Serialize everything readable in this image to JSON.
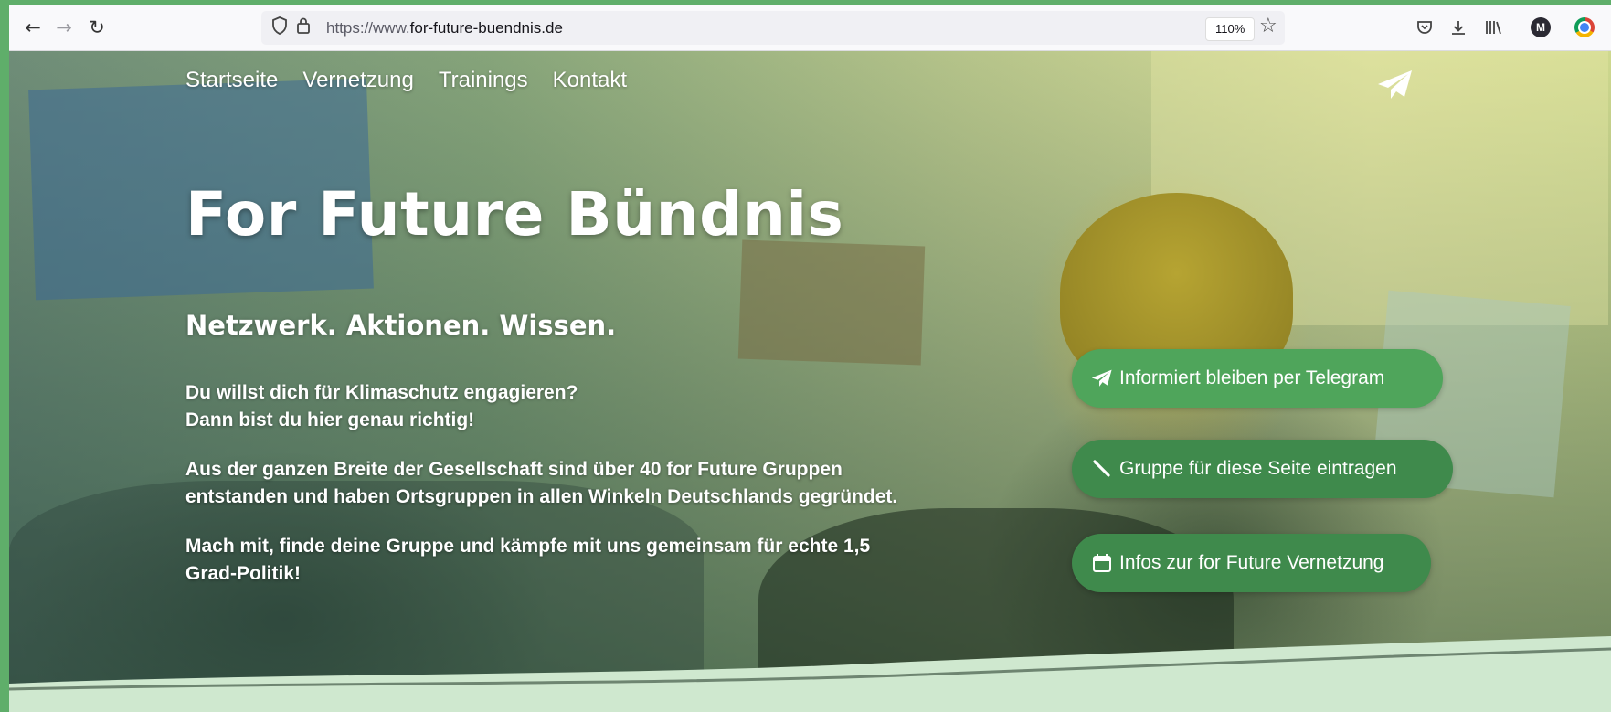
{
  "browser": {
    "url_prefix": "https://www.",
    "url_domain": "for-future-buendnis.de",
    "zoom": "110%",
    "profile_initial": "M"
  },
  "nav": {
    "items": [
      {
        "label": "Startseite"
      },
      {
        "label": "Vernetzung"
      },
      {
        "label": "Trainings"
      },
      {
        "label": "Kontakt"
      }
    ]
  },
  "hero": {
    "title": "For Future Bündnis",
    "subtitle": "Netzwerk. Aktionen. Wissen.",
    "intro_line1": "Du willst dich für Klimaschutz engagieren?",
    "intro_line2": "Dann bist du hier genau richtig!",
    "para2_line1": "Aus der ganzen Breite der Gesellschaft sind über 40 for Future Gruppen",
    "para2_line2": "entstanden und haben Ortsgruppen in allen Winkeln Deutschlands gegründet.",
    "para3_line1": "Mach mit, finde deine Gruppe und kämpfe mit uns gemeinsam für echte 1,5",
    "para3_line2": "Grad-Politik!"
  },
  "buttons": {
    "telegram": "Informiert bleiben per Telegram",
    "register": "Gruppe für diese Seite eintragen",
    "info": "Infos zur for Future Vernetzung"
  },
  "colors": {
    "brand_green": "#4fa55b",
    "button_green_dark": "#3f8a4c",
    "footer_light_green": "#cfe8cf"
  },
  "icons": [
    "back-icon",
    "forward-icon",
    "reload-icon",
    "shield-icon",
    "lock-icon",
    "star-icon",
    "pocket-icon",
    "download-icon",
    "library-icon",
    "telegram-plane-icon",
    "pencil-icon",
    "calendar-icon"
  ]
}
